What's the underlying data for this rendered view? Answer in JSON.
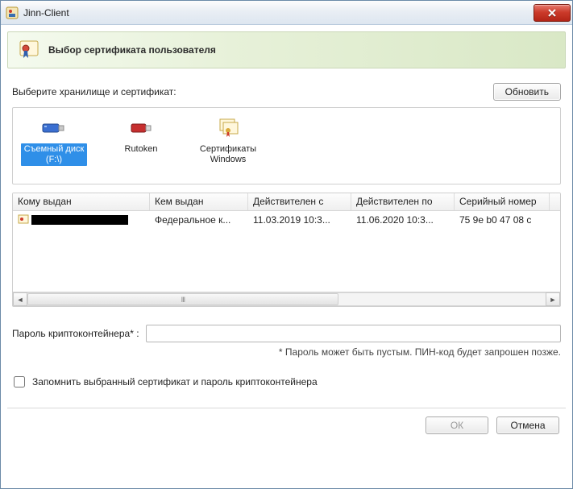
{
  "window": {
    "title": "Jinn-Client"
  },
  "header": {
    "heading": "Выбор сертификата пользователя"
  },
  "selector_label": "Выберите хранилище и сертификат:",
  "buttons": {
    "refresh": "Обновить",
    "ok": "ОК",
    "cancel": "Отмена"
  },
  "storages": {
    "items": [
      {
        "label": "Съемный диск (F:\\)",
        "selected": true
      },
      {
        "label": "Rutoken",
        "selected": false
      },
      {
        "label": "Сертификаты Windows",
        "selected": false
      }
    ]
  },
  "table": {
    "columns": {
      "issued_to": "Кому выдан",
      "issued_by": "Кем выдан",
      "valid_from": "Действителен с",
      "valid_to": "Действителен по",
      "serial": "Серийный номер"
    },
    "rows": [
      {
        "issued_to": "",
        "issued_by": "Федеральное к...",
        "valid_from": "11.03.2019 10:3...",
        "valid_to": "11.06.2020 10:3...",
        "serial": "75 9e b0 47 08 c"
      }
    ]
  },
  "password": {
    "label": "Пароль криптоконтейнера* :",
    "value": "",
    "hint": "* Пароль может быть пустым. ПИН-код будет запрошен позже."
  },
  "remember": {
    "label": "Запомнить выбранный сертификат и пароль криптоконтейнера",
    "checked": false
  }
}
